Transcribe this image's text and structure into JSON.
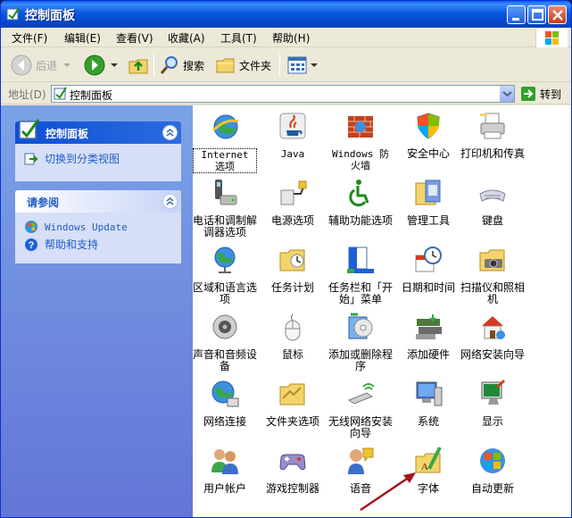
{
  "window": {
    "title": "控制面板"
  },
  "menu": [
    "文件(F)",
    "编辑(E)",
    "查看(V)",
    "收藏(A)",
    "工具(T)",
    "帮助(H)"
  ],
  "toolbar": {
    "back_label": "后退",
    "search_label": "搜索",
    "folders_label": "文件夹"
  },
  "address": {
    "label": "地址(D)",
    "value": "控制面板",
    "go_label": "转到"
  },
  "sidebar": {
    "panel1": {
      "title": "控制面板",
      "task": "切换到分类视图"
    },
    "panel2": {
      "title": "请参阅",
      "links": [
        "Windows Update",
        "帮助和支持"
      ]
    }
  },
  "items": [
    {
      "label": "Internet 选项",
      "icon": "internet-options-icon"
    },
    {
      "label": "Java",
      "icon": "java-icon"
    },
    {
      "label": "Windows 防火墙",
      "icon": "firewall-icon"
    },
    {
      "label": "安全中心",
      "icon": "security-center-icon"
    },
    {
      "label": "打印机和传真",
      "icon": "printer-icon"
    },
    {
      "label": "电话和调制解调器选项",
      "icon": "phone-modem-icon"
    },
    {
      "label": "电源选项",
      "icon": "power-options-icon"
    },
    {
      "label": "辅助功能选项",
      "icon": "accessibility-icon"
    },
    {
      "label": "管理工具",
      "icon": "admin-tools-icon"
    },
    {
      "label": "键盘",
      "icon": "keyboard-icon"
    },
    {
      "label": "区域和语言选项",
      "icon": "globe-icon"
    },
    {
      "label": "任务计划",
      "icon": "scheduled-tasks-icon"
    },
    {
      "label": "任务栏和「开始」菜单",
      "icon": "taskbar-icon"
    },
    {
      "label": "日期和时间",
      "icon": "clock-icon"
    },
    {
      "label": "扫描仪和照相机",
      "icon": "scanner-icon"
    },
    {
      "label": "声音和音频设备",
      "icon": "speaker-icon"
    },
    {
      "label": "鼠标",
      "icon": "mouse-icon"
    },
    {
      "label": "添加或删除程序",
      "icon": "add-remove-programs-icon"
    },
    {
      "label": "添加硬件",
      "icon": "add-hardware-icon"
    },
    {
      "label": "网络安装向导",
      "icon": "network-setup-icon"
    },
    {
      "label": "网络连接",
      "icon": "network-connections-icon"
    },
    {
      "label": "文件夹选项",
      "icon": "folder-options-icon"
    },
    {
      "label": "无线网络安装向导",
      "icon": "wireless-icon"
    },
    {
      "label": "系统",
      "icon": "system-icon"
    },
    {
      "label": "显示",
      "icon": "display-icon"
    },
    {
      "label": "用户帐户",
      "icon": "user-accounts-icon"
    },
    {
      "label": "游戏控制器",
      "icon": "game-controller-icon"
    },
    {
      "label": "语音",
      "icon": "speech-icon"
    },
    {
      "label": "字体",
      "icon": "fonts-icon"
    },
    {
      "label": "自动更新",
      "icon": "windows-update-icon"
    }
  ]
}
